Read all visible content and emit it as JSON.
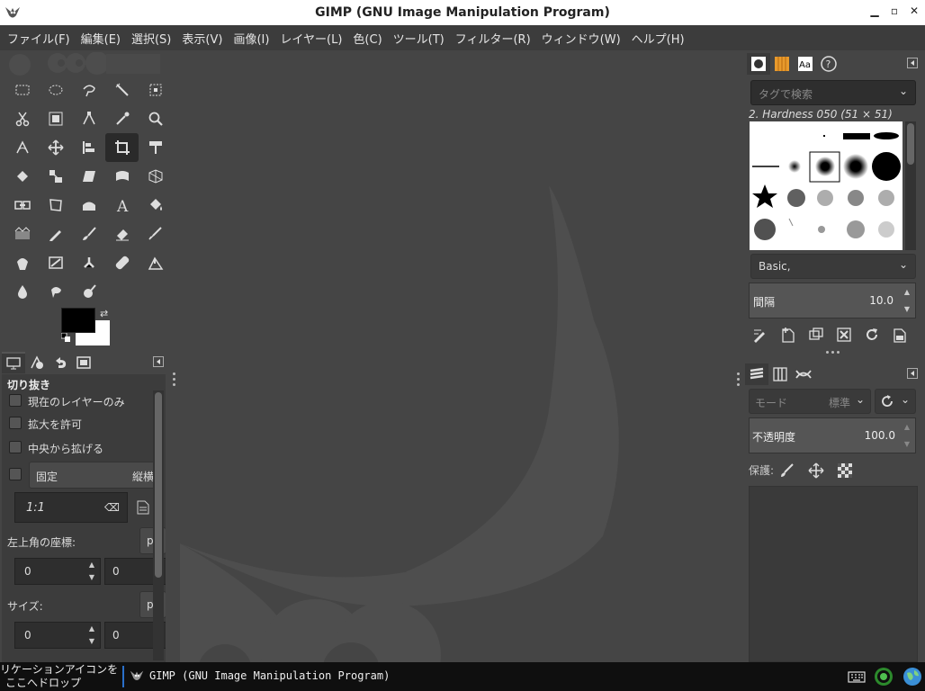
{
  "window": {
    "title": "GIMP (GNU Image Manipulation Program)",
    "controls": [
      "minimize-icon",
      "maximize-icon",
      "close-icon"
    ]
  },
  "menu": [
    "ファイル(F)",
    "編集(E)",
    "選択(S)",
    "表示(V)",
    "画像(I)",
    "レイヤー(L)",
    "色(C)",
    "ツール(T)",
    "フィルター(R)",
    "ウィンドウ(W)",
    "ヘルプ(H)"
  ],
  "tool_options": {
    "title": "切り抜き",
    "current_layer_only": "現在のレイヤーのみ",
    "allow_growing": "拡大を許可",
    "expand_from_center": "中央から拡げる",
    "fixed_label": "固定",
    "fixed_mode": "縦横",
    "ratio_value": "1:1",
    "position_label": "左上角の座標:",
    "position_unit": "p",
    "position_x": "0",
    "position_y": "0",
    "size_label": "サイズ:",
    "size_unit": "p",
    "size_w": "0",
    "size_h": "0"
  },
  "brushes": {
    "tag_placeholder": "タグで検索",
    "selected_brush": "2. Hardness 050 (51 × 51)",
    "preset": "Basic,",
    "spacing_label": "間隔",
    "spacing_value": "10.0"
  },
  "layers": {
    "mode_placeholder": "モード",
    "mode_value": "標準",
    "opacity_label": "不透明度",
    "opacity_value": "100.0",
    "lock_label": "保護:"
  },
  "taskbar": {
    "hint_line1": "リケーションアイコンを",
    "hint_line2": "ここへドロップ",
    "task_title": "GIMP (GNU Image Manipulation Program)"
  },
  "colors": {
    "foreground": "#000000",
    "background": "#ffffff",
    "accent": "#2a6fc9"
  }
}
